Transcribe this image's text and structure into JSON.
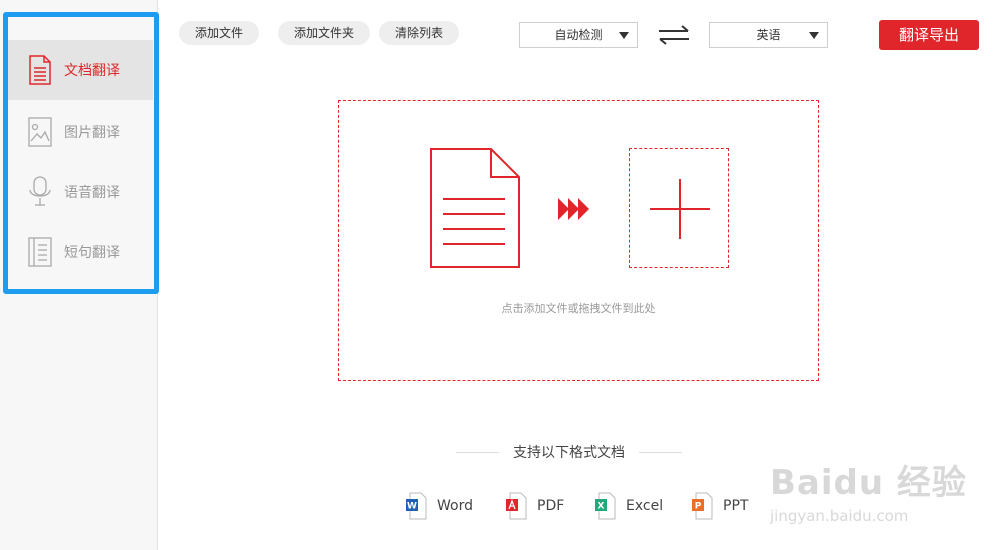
{
  "sidebar": {
    "items": [
      {
        "label": "文档翻译",
        "icon": "document-icon",
        "active": true
      },
      {
        "label": "图片翻译",
        "icon": "image-icon",
        "active": false
      },
      {
        "label": "语音翻译",
        "icon": "microphone-icon",
        "active": false
      },
      {
        "label": "短句翻译",
        "icon": "text-page-icon",
        "active": false
      }
    ]
  },
  "toolbar": {
    "add_file": "添加文件",
    "add_folder": "添加文件夹",
    "clear_list": "清除列表",
    "source_language": "自动检测",
    "target_language": "英语",
    "swap_icon": "swap-arrows-icon",
    "export_label": "翻译导出"
  },
  "dropzone": {
    "hint": "点击添加文件或拖拽文件到此处",
    "file_icon": "file-icon",
    "arrow_icon": "triple-arrow-icon",
    "plus_icon": "plus-icon"
  },
  "formats": {
    "title": "支持以下格式文档",
    "items": [
      {
        "label": "Word",
        "icon": "word-icon",
        "color": "#1f5fb5"
      },
      {
        "label": "PDF",
        "icon": "pdf-icon",
        "color": "#e0262a"
      },
      {
        "label": "Excel",
        "icon": "excel-icon",
        "color": "#1faa7a"
      },
      {
        "label": "PPT",
        "icon": "ppt-icon",
        "color": "#e8702a"
      }
    ]
  },
  "watermark": {
    "brand": "Baidu 经验",
    "url": "jingyan.baidu.com"
  },
  "colors": {
    "accent": "#e0262a",
    "highlight": "#1e9cf0"
  }
}
